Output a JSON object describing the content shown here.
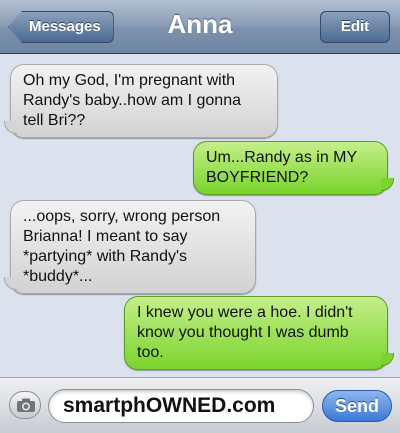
{
  "header": {
    "back_label": "Messages",
    "title": "Anna",
    "edit_label": "Edit"
  },
  "messages": [
    {
      "side": "incoming",
      "text": "Oh my God, I'm pregnant with Randy's baby..how am I gonna tell Bri??"
    },
    {
      "side": "outgoing",
      "text": "Um...Randy as in MY BOYFRIEND?"
    },
    {
      "side": "incoming",
      "text": "...oops, sorry, wrong person Brianna! I meant to say *partying* with Randy's *buddy*..."
    },
    {
      "side": "outgoing",
      "text": "I knew you were a hoe. I didn't know you thought I was dumb too."
    }
  ],
  "composer": {
    "camera_icon": "camera-icon",
    "input_value": "smartphOWNED.com",
    "send_label": "Send"
  },
  "colors": {
    "incoming_bubble": "#d8d8d8",
    "outgoing_bubble": "#8ddc3f",
    "navbar": "#8a9db6",
    "send_button": "#3b78d6"
  }
}
